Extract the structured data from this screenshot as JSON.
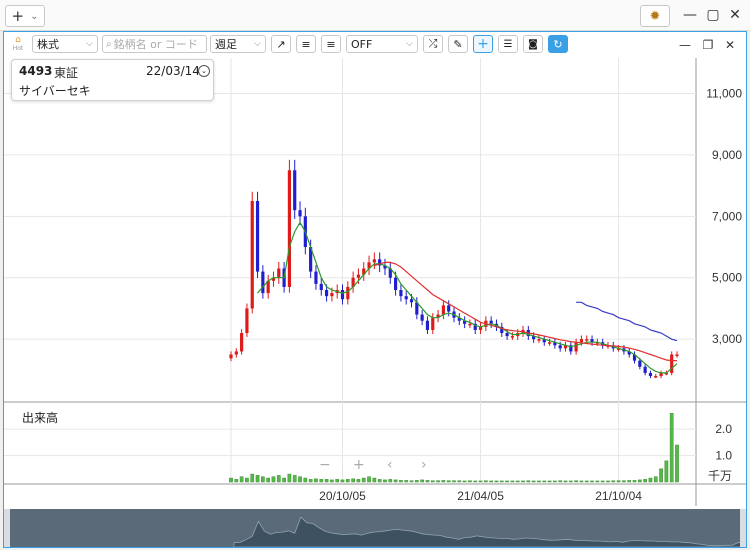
{
  "titlebar": {
    "add_label": "+",
    "dropdown_label": "⌄",
    "settings_icon": "gear-icon"
  },
  "toolbar": {
    "home_label": "Hot",
    "category": "株式",
    "search_placeholder": "銘柄名 or コード",
    "period": "週足",
    "indicator": "OFF"
  },
  "stock": {
    "code": "4493",
    "exchange": "東証",
    "date": "22/03/14",
    "name": "サイバーセキ"
  },
  "volume_panel": {
    "label": "出来高",
    "unit": "千万"
  },
  "chart_data": [
    {
      "type": "candlestick",
      "title": "",
      "x_tick_labels": [
        "20/10/05",
        "21/04/05",
        "21/10/04"
      ],
      "y_tick_labels": [
        "11,000",
        "9,000",
        "7,000",
        "5,000",
        "3,000"
      ],
      "ylim": [
        1800,
        11700
      ],
      "grid": true,
      "series": [
        {
          "name": "",
          "kind": "ohlc_close",
          "values": [
            2500,
            2600,
            3200,
            4000,
            7500,
            5200,
            4500,
            4900,
            5000,
            5300,
            4700,
            8500,
            7200,
            7000,
            6000,
            5200,
            4800,
            4600,
            4400,
            4500,
            4600,
            4300,
            4700,
            5000,
            5100,
            5300,
            5500,
            5600,
            5400,
            5300,
            5000,
            4600,
            4400,
            4300,
            4200,
            3800,
            3600,
            3300,
            3700,
            3800,
            4100,
            3900,
            3700,
            3600,
            3500,
            3500,
            3300,
            3400,
            3600,
            3500,
            3400,
            3200,
            3100,
            3100,
            3200,
            3300,
            3100,
            3000,
            3000,
            2900,
            2900,
            2800,
            2700,
            2800,
            2600,
            2900,
            3000,
            3000,
            2900,
            2900,
            2800,
            2800,
            2700,
            2700,
            2600,
            2500,
            2300,
            2100,
            1900,
            1800,
            1800,
            1900,
            1900,
            2500,
            2500
          ]
        },
        {
          "name": "",
          "kind": "moving_average",
          "color": "#2a9a2a",
          "values": [
            null,
            null,
            null,
            null,
            null,
            4500,
            4700,
            4900,
            5000,
            5000,
            5000,
            6000,
            6500,
            6800,
            6500,
            6000,
            5500,
            5000,
            4700,
            4600,
            4550,
            4500,
            4550,
            4700,
            4900,
            5100,
            5300,
            5450,
            5450,
            5400,
            5300,
            5100,
            4800,
            4600,
            4400,
            4200,
            4000,
            3800,
            3700,
            3700,
            3800,
            3850,
            3800,
            3700,
            3600,
            3550,
            3450,
            3400,
            3450,
            3500,
            3450,
            3350,
            3250,
            3150,
            3150,
            3200,
            3150,
            3100,
            3050,
            3000,
            2950,
            2900,
            2850,
            2800,
            2750,
            2800,
            2850,
            2900,
            2900,
            2900,
            2850,
            2800,
            2750,
            2700,
            2650,
            2600,
            2500,
            2350,
            2200,
            2050,
            1950,
            1900,
            1900,
            2050,
            2200
          ]
        },
        {
          "name": "",
          "kind": "moving_average",
          "color": "#e03030",
          "values": [
            null,
            null,
            null,
            null,
            null,
            null,
            null,
            null,
            null,
            null,
            null,
            null,
            null,
            null,
            null,
            null,
            null,
            null,
            null,
            null,
            null,
            null,
            null,
            null,
            null,
            null,
            null,
            5400,
            5450,
            5500,
            5500,
            5450,
            5350,
            5200,
            5050,
            4900,
            4750,
            4600,
            4450,
            4350,
            4250,
            4150,
            4050,
            3950,
            3850,
            3750,
            3650,
            3550,
            3500,
            3450,
            3400,
            3350,
            3300,
            3280,
            3260,
            3240,
            3200,
            3170,
            3140,
            3100,
            3060,
            3020,
            2980,
            2950,
            2920,
            2900,
            2880,
            2860,
            2840,
            2820,
            2800,
            2790,
            2780,
            2760,
            2740,
            2710,
            2670,
            2620,
            2560,
            2500,
            2440,
            2380,
            2320,
            2300,
            2300
          ]
        },
        {
          "name": "",
          "kind": "moving_average",
          "color": "#3b3bc8",
          "values": [
            null,
            null,
            null,
            null,
            null,
            null,
            null,
            null,
            null,
            null,
            null,
            null,
            null,
            null,
            null,
            null,
            null,
            null,
            null,
            null,
            null,
            null,
            null,
            null,
            null,
            null,
            null,
            null,
            null,
            null,
            null,
            null,
            null,
            null,
            null,
            null,
            null,
            null,
            null,
            null,
            null,
            null,
            null,
            null,
            null,
            null,
            null,
            null,
            null,
            null,
            null,
            null,
            null,
            null,
            null,
            null,
            null,
            null,
            null,
            null,
            null,
            null,
            null,
            null,
            null,
            4200,
            4200,
            4100,
            4050,
            4000,
            3900,
            3850,
            3800,
            3700,
            3650,
            3600,
            3500,
            3450,
            3400,
            3300,
            3250,
            3200,
            3100,
            3000,
            2950
          ]
        }
      ]
    },
    {
      "type": "bar",
      "title": "",
      "y_tick_labels": [
        "2.0",
        "1.0"
      ],
      "unit": "千万",
      "series": [
        {
          "name": "",
          "values": [
            0.15,
            0.1,
            0.2,
            0.15,
            0.3,
            0.25,
            0.2,
            0.15,
            0.2,
            0.25,
            0.15,
            0.3,
            0.25,
            0.2,
            0.15,
            0.1,
            0.12,
            0.1,
            0.1,
            0.08,
            0.1,
            0.08,
            0.1,
            0.12,
            0.1,
            0.15,
            0.2,
            0.15,
            0.1,
            0.08,
            0.1,
            0.08,
            0.06,
            0.06,
            0.05,
            0.06,
            0.08,
            0.06,
            0.05,
            0.05,
            0.06,
            0.05,
            0.05,
            0.05,
            0.04,
            0.05,
            0.04,
            0.04,
            0.05,
            0.04,
            0.04,
            0.04,
            0.04,
            0.04,
            0.04,
            0.04,
            0.05,
            0.04,
            0.04,
            0.04,
            0.04,
            0.04,
            0.05,
            0.04,
            0.04,
            0.05,
            0.04,
            0.04,
            0.04,
            0.04,
            0.04,
            0.04,
            0.05,
            0.05,
            0.05,
            0.06,
            0.06,
            0.08,
            0.1,
            0.15,
            0.2,
            0.5,
            0.8,
            2.6,
            1.4
          ]
        }
      ]
    }
  ],
  "colors": {
    "up": "#e01919",
    "down": "#1f1fd0",
    "volume": "#55b84a",
    "accent": "#3aa0e6"
  }
}
